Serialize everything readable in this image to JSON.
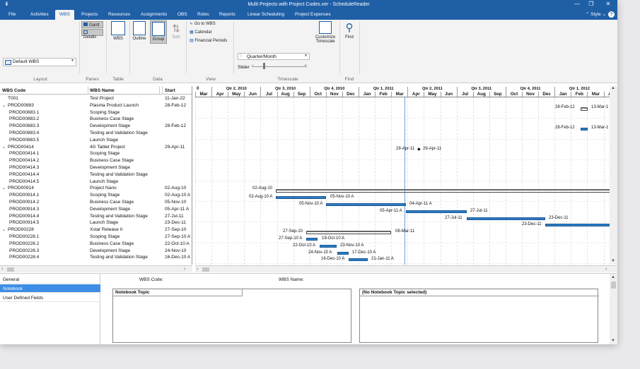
{
  "window": {
    "title": "Multi Projects with Project Codes.xer - ScheduleReader"
  },
  "menu": {
    "items": [
      "File",
      "Activities",
      "WBS",
      "Projects",
      "Resources",
      "Assignments",
      "OBS",
      "Roles",
      "Reports",
      "Linear Scheduling",
      "Project Expenses"
    ],
    "active": "WBS",
    "style": "Style"
  },
  "ribbon": {
    "layout_select": "Default WBS",
    "panes_gantt": "Gantt",
    "panes_details": "Details",
    "wbs_btn": "WBS",
    "outline_btn": "Outline",
    "group_btn": "Group",
    "sort_btn": "Sort",
    "goto_wbs": "Go to WBS",
    "calendar": "Calendar",
    "financial_periods": "Financial Periods",
    "timescale_select": "Quarter/Month",
    "slider_label": "Slider",
    "customize_label": "Customize Timescale",
    "find_label": "Find",
    "groups": {
      "layout": "Layout",
      "panes": "Panes",
      "table": "Table",
      "data": "Data",
      "view": "View",
      "timescale": "Timescale",
      "find": "Find"
    }
  },
  "grid": {
    "headers": {
      "code": "WBS Code",
      "name": "WBS Name",
      "start": "Start"
    },
    "rows": [
      {
        "code": "T001",
        "name": "Test Project",
        "start": "11-Jan-22",
        "lvl": 0,
        "exp": false
      },
      {
        "code": "PROD00883",
        "name": "Plasma Product Launch",
        "start": "28-Feb-12",
        "lvl": 0,
        "exp": true
      },
      {
        "code": "PROD00883.1",
        "name": "Scoping Stage",
        "start": "",
        "lvl": 1
      },
      {
        "code": "PROD00883.2",
        "name": "Business Case Stage",
        "start": "",
        "lvl": 1
      },
      {
        "code": "PROD00883.3",
        "name": "Development Stage",
        "start": "28-Feb-12",
        "lvl": 1
      },
      {
        "code": "PROD00883.4",
        "name": "Testing and Validation Stage",
        "start": "",
        "lvl": 1
      },
      {
        "code": "PROD00883.5",
        "name": "Launch Stage",
        "start": "",
        "lvl": 1
      },
      {
        "code": "PROD00414",
        "name": "4G Tablet Project",
        "start": "29-Apr-11",
        "lvl": 0,
        "exp": true
      },
      {
        "code": "PROD00414.1",
        "name": "Scoping Stage",
        "start": "",
        "lvl": 1
      },
      {
        "code": "PROD00414.2",
        "name": "Business Case Stage",
        "start": "",
        "lvl": 1
      },
      {
        "code": "PROD00414.3",
        "name": "Development Stage",
        "start": "",
        "lvl": 1
      },
      {
        "code": "PROD00414.4",
        "name": "Testing and Validation Stage",
        "start": "",
        "lvl": 1
      },
      {
        "code": "PROD00414.5",
        "name": "Launch Stage",
        "start": "",
        "lvl": 1
      },
      {
        "code": "PROD00914",
        "name": "Project Nano",
        "start": "02-Aug-10",
        "lvl": 0,
        "exp": true
      },
      {
        "code": "PROD00914.1",
        "name": "Scoping Stage",
        "start": "02-Aug-10 A",
        "lvl": 1
      },
      {
        "code": "PROD00914.2",
        "name": "Business Case Stage",
        "start": "05-Nov-10",
        "lvl": 1
      },
      {
        "code": "PROD00914.3",
        "name": "Development Stage",
        "start": "05-Apr-11 A",
        "lvl": 1
      },
      {
        "code": "PROD00914.4",
        "name": "Testing and Validation Stage",
        "start": "27-Jul-11",
        "lvl": 1
      },
      {
        "code": "PROD00914.5",
        "name": "Launch Stage",
        "start": "23-Dec-11",
        "lvl": 1
      },
      {
        "code": "PROD00228",
        "name": "Xstar Release II",
        "start": "27-Sep-10",
        "lvl": 0,
        "exp": true
      },
      {
        "code": "PROD00228.1",
        "name": "Scoping Stage",
        "start": "27-Sep-10 A",
        "lvl": 1
      },
      {
        "code": "PROD00228.2",
        "name": "Business Case Stage",
        "start": "22-Oct-10 A",
        "lvl": 1
      },
      {
        "code": "PROD00228.3",
        "name": "Development Stage",
        "start": "24-Nov-10",
        "lvl": 1
      },
      {
        "code": "PROD00228.4",
        "name": "Testing and Validation Stage",
        "start": "16-Dec-10 A",
        "lvl": 1
      }
    ]
  },
  "timescale": {
    "quarters": [
      "0",
      "Qtr 2, 2010",
      "Qtr 3, 2010",
      "Qtr 4, 2010",
      "Qtr 1, 2011",
      "Qtr 2, 2011",
      "Qtr 3, 2011",
      "Qtr 4, 2011",
      "Qtr 1, 2012"
    ],
    "months": [
      "Mar",
      "Apr",
      "May",
      "Jun",
      "Jul",
      "Aug",
      "Sep",
      "Oct",
      "Nov",
      "Dec",
      "Jan",
      "Feb",
      "Mar",
      "Apr",
      "May",
      "Jun",
      "Jul",
      "Aug",
      "Sep",
      "Oct",
      "Nov",
      "Dec",
      "Jan",
      "Feb",
      "Mar",
      "Apr"
    ]
  },
  "gantt": {
    "labels": {
      "r1a": "28-Feb-12",
      "r1b": "13-Mar-1",
      "r4a": "28-Feb-12",
      "r4b": "13-Mar-1",
      "r7a": "29-Apr-11",
      "r7b": "29-Apr-11",
      "r13a": "02-Aug-10",
      "r14a": "02-Aug-10 A",
      "r14b": "05-Nov-10 A",
      "r15a": "05-Nov-10 A",
      "r15b": "04-Apr-11 A",
      "r16a": "05-Apr-11 A",
      "r16b": "27-Jul-11",
      "r17a": "27-Jul-11",
      "r17b": "23-Dec-11",
      "r18a": "23-Dec-11",
      "r19a": "27-Sep-10",
      "r19b": "08-Mar-11",
      "r20a": "27-Sep-10 A",
      "r20b": "19-Oct-10 A",
      "r21a": "22-Oct-10 A",
      "r21b": "23-Nov-10 A",
      "r22a": "24-Nov-10 A",
      "r22b": "17-Dec-10 A",
      "r23a": "16-Dec-10 A",
      "r23b": "21-Jan-11 A"
    }
  },
  "bottom": {
    "tabs": [
      "General",
      "Notebook",
      "User Defined Fields"
    ],
    "active_tab": "Notebook",
    "wbs_code_label": "WBS Code:",
    "wbs_name_label": "WBS Name:",
    "notebook_topic_header": "Notebook Topic",
    "no_topic": "(No Notebook Topic selected)"
  }
}
